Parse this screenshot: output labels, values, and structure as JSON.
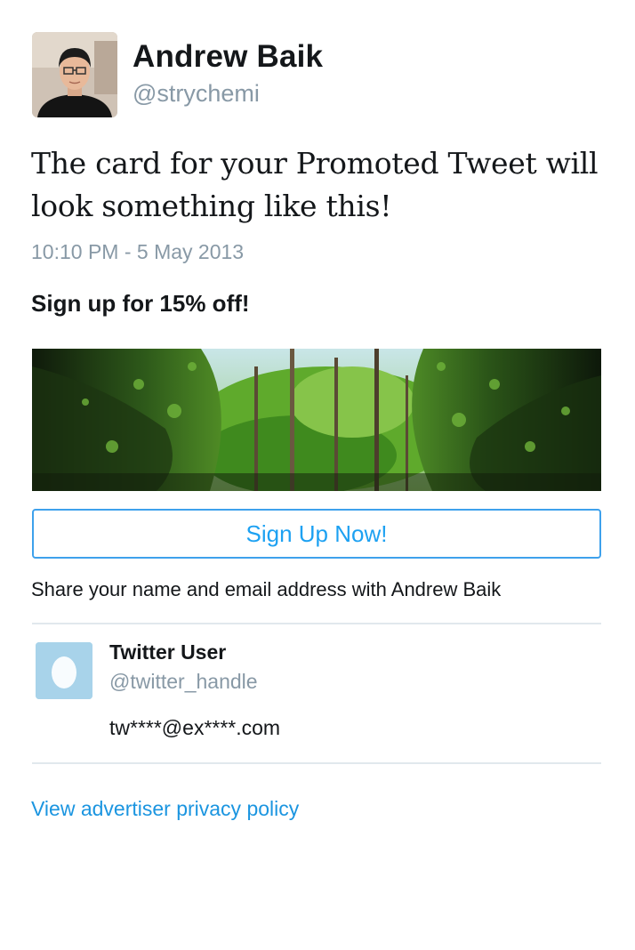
{
  "author": {
    "name": "Andrew Baik",
    "handle": "@strychemi",
    "avatar_icon": "profile-photo"
  },
  "tweet": {
    "text": "The card for your Promoted Tweet will look something like this!",
    "timestamp": "10:10 PM - 5 May 2013"
  },
  "card": {
    "title": "Sign up for 15% off!",
    "image_description_icon": "forest-canyon-image",
    "cta_label": "Sign Up Now!",
    "share_text": "Share your name and email address with Andrew Baik"
  },
  "user": {
    "name": "Twitter User",
    "handle": "@twitter_handle",
    "email": "tw****@ex****.com",
    "avatar_icon": "egg-avatar-icon"
  },
  "footer": {
    "privacy_link": "View advertiser privacy policy"
  },
  "colors": {
    "accent": "#1da1f2",
    "link": "#1b95e0",
    "muted": "#8899a6",
    "divider": "#e1e8ed",
    "egg_bg": "#a8d3ea"
  }
}
